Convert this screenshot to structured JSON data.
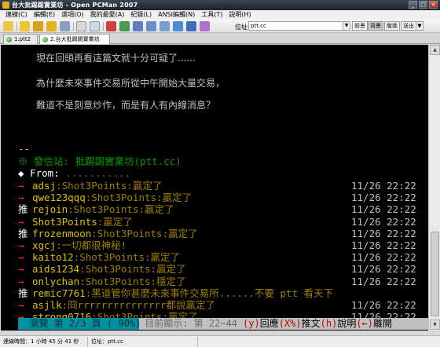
{
  "window": {
    "title": "台大批踢踢實業坊 - Open PCMan 2007"
  },
  "menu": [
    "連線(C)",
    "編輯(E)",
    "選項(O)",
    "我的最愛(A)",
    "紀錄(L)",
    "ANSI編輯(N)",
    "工具(T)",
    "說明(H)"
  ],
  "toolbar": {
    "address_label": "位址：",
    "address_value": "ptt.cc",
    "buttons": [
      "前景",
      "背景",
      "版面",
      "送出"
    ],
    "active_button": "背景"
  },
  "tabs": [
    {
      "label": "1.ptt2",
      "active": false
    },
    {
      "label": "2.台大批踢踢實業坊",
      "active": true
    }
  ],
  "article": {
    "lines": [
      "現在回頭再看這篇文就十分可疑了......",
      "為什麼未來事件交易所從中午開始大量交易，",
      "難道不是刻意炒作，而是有人有內線消息？"
    ],
    "separator": "--",
    "signature": "※ 發信站: 批踢踢實業坊(ptt.cc)",
    "from_label": "◆ From:",
    "from_value": "..........."
  },
  "pushes": [
    {
      "tag": "→",
      "user": "adsj",
      "msg": ":Shot3Points:贏定了",
      "time": "11/26 22:22"
    },
    {
      "tag": "→",
      "user": "qwe123qqq",
      "msg": ":Shot3Points:贏定了",
      "time": "11/26 22:22"
    },
    {
      "tag": "推",
      "user": "rejoin",
      "msg": ":Shot3Points:贏定了",
      "time": "11/26 22:22"
    },
    {
      "tag": "→",
      "user": "Shot3Points",
      "msg": ":贏定了",
      "time": "11/26 22:22"
    },
    {
      "tag": "推",
      "user": "frozenmoon",
      "msg": ":Shot3Points:贏定了",
      "time": "11/26 22:22"
    },
    {
      "tag": "→",
      "user": "xgcj",
      "msg": ":一切都很神秘!",
      "time": "11/26 22:22"
    },
    {
      "tag": "→",
      "user": "kaito12",
      "msg": ":Shot3Points:贏定了",
      "time": "11/26 22:22"
    },
    {
      "tag": "→",
      "user": "aids1234",
      "msg": ":Shot3Points:贏定了",
      "time": "11/26 22:22"
    },
    {
      "tag": "→",
      "user": "onlychan",
      "msg": ":Shot3Points:穩定了",
      "time": "11/26 22:22"
    },
    {
      "tag": "推",
      "user": "remic7761",
      "msg": ":黑道管你甚麼未來事件交易所......不要 ptt 看天下",
      "time": ""
    },
    {
      "tag": "→",
      "user": "asjlk",
      "msg": ":冏rrrrrrrrrrrrrrr都說贏定了",
      "time": "11/26 22:22"
    },
    {
      "tag": "→",
      "user": "strong0716",
      "msg": ":Shot3Points:贏定了",
      "time": "11/26 22:22"
    }
  ],
  "footer": {
    "browse": "  瀏覽 第 2/3 頁 ( 90%) ",
    "range": " 目前顯示: 第 22~44 行  ",
    "reply_key": "(y)",
    "reply_label": "回應",
    "x_key": "(X%)",
    "push_label": "推文",
    "help_key": "(h)",
    "help_label": "說明",
    "leave_key": "(←)",
    "leave_label": "離開"
  },
  "status": {
    "conn_time": "連線時間：1 小時 45 分 41 秒",
    "address": "位址：ptt.cc"
  },
  "colors": {
    "terminal_bg": "#000000",
    "push_arrow": "#ff2020",
    "push_user": "#e0c000",
    "push_msg": "#a08000",
    "signature": "#00a000",
    "footer_browse_bg": "#0090a0",
    "footer_rest_bg": "#c0c0c0"
  }
}
